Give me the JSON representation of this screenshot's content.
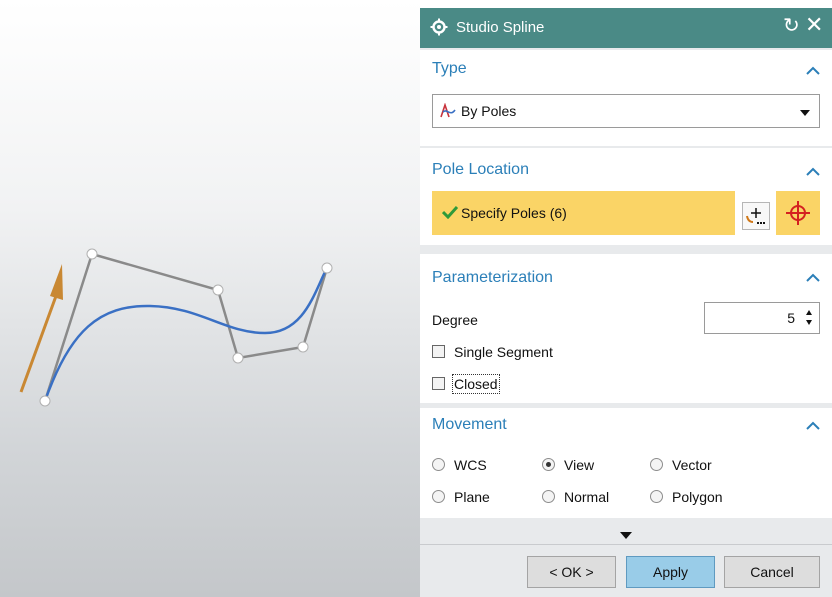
{
  "dialog": {
    "title": "Studio Spline",
    "icons": {
      "title": "gear-icon",
      "reset": "reset-icon",
      "close": "close-icon"
    }
  },
  "type_section": {
    "header": "Type",
    "selected_value": "By Poles",
    "icon": "by-poles-icon"
  },
  "pole_location_section": {
    "header": "Pole Location",
    "specify_label": "Specify Poles (6)",
    "selected": true,
    "buttons": [
      "point-dialog-icon",
      "point-snap-icon"
    ]
  },
  "parameterization_section": {
    "header": "Parameterization",
    "degree_label": "Degree",
    "degree_value": "5",
    "single_segment": {
      "label": "Single Segment",
      "checked": false
    },
    "closed": {
      "label": "Closed",
      "checked": false
    }
  },
  "movement_section": {
    "header": "Movement",
    "options": [
      {
        "label": "WCS",
        "selected": false
      },
      {
        "label": "View",
        "selected": true
      },
      {
        "label": "Vector",
        "selected": false
      },
      {
        "label": "Plane",
        "selected": false
      },
      {
        "label": "Normal",
        "selected": false
      },
      {
        "label": "Polygon",
        "selected": false
      }
    ]
  },
  "footer": {
    "ok_label": "< OK >",
    "apply_label": "Apply",
    "cancel_label": "Cancel"
  },
  "colors": {
    "title_bar": "#4a8a86",
    "section_header_text": "#2b7fb8",
    "selection_highlight": "#fad466",
    "apply_button": "#99cce8",
    "spline_curve": "#3a70c4",
    "control_polygon": "#8a8a8a",
    "direction_arrow": "#c98833"
  }
}
